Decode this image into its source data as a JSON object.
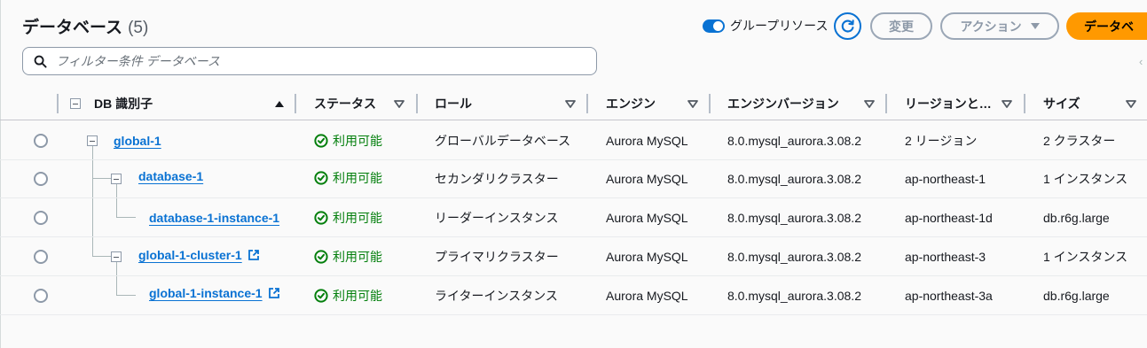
{
  "header": {
    "title": "データベース",
    "count": "(5)",
    "group_toggle_label": "グループリソース",
    "modify_label": "変更",
    "actions_label": "アクション",
    "create_label": "データベ"
  },
  "filter": {
    "placeholder": "フィルター条件 データベース"
  },
  "table": {
    "columns": [
      "DB 識別子",
      "ステータス",
      "ロール",
      "エンジン",
      "エンジンバージョン",
      "リージョンと…",
      "サイズ"
    ],
    "rows": [
      {
        "id": "global-1",
        "status": "利用可能",
        "role": "グローバルデータベース",
        "engine": "Aurora MySQL",
        "version": "8.0.mysql_aurora.3.08.2",
        "region": "2 リージョン",
        "size": "2 クラスター"
      },
      {
        "id": "database-1",
        "status": "利用可能",
        "role": "セカンダリクラスター",
        "engine": "Aurora MySQL",
        "version": "8.0.mysql_aurora.3.08.2",
        "region": "ap-northeast-1",
        "size": "1 インスタンス"
      },
      {
        "id": "database-1-instance-1",
        "status": "利用可能",
        "role": "リーダーインスタンス",
        "engine": "Aurora MySQL",
        "version": "8.0.mysql_aurora.3.08.2",
        "region": "ap-northeast-1d",
        "size": "db.r6g.large"
      },
      {
        "id": "global-1-cluster-1",
        "status": "利用可能",
        "role": "プライマリクラスター",
        "engine": "Aurora MySQL",
        "version": "8.0.mysql_aurora.3.08.2",
        "region": "ap-northeast-3",
        "size": "1 インスタンス"
      },
      {
        "id": "global-1-instance-1",
        "status": "利用可能",
        "role": "ライターインスタンス",
        "engine": "Aurora MySQL",
        "version": "8.0.mysql_aurora.3.08.2",
        "region": "ap-northeast-3a",
        "size": "db.r6g.large"
      }
    ]
  },
  "colors": {
    "accent": "#0972d3",
    "success": "#037f0c",
    "primary_button": "#ff9900"
  },
  "icons": [
    "refresh-icon",
    "search-icon",
    "check-circle-icon",
    "external-link-icon",
    "sort-ascending-icon",
    "sort-icon"
  ]
}
